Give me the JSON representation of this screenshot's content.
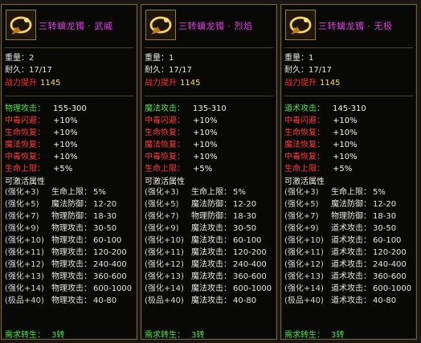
{
  "panels": [
    {
      "title": "三转螭龙镯 · 武威",
      "weight_label": "重量：",
      "weight": "2",
      "durability_label": "耐久：",
      "durability": "17/17",
      "power_label": "战力提升",
      "power_value": "1145",
      "attributes": [
        {
          "label": "物理攻击：",
          "value": "155-300",
          "color": "green"
        },
        {
          "label": "中毒闪避：",
          "value": "+10%",
          "color": "red"
        },
        {
          "label": "生命恢复：",
          "value": "+10%",
          "color": "red"
        },
        {
          "label": "魔法恢复：",
          "value": "+10%",
          "color": "red"
        },
        {
          "label": "中毒恢复：",
          "value": "+10%",
          "color": "red"
        },
        {
          "label": "生命上限：",
          "value": "+5%",
          "color": "red"
        }
      ],
      "activate_title": "可激活属性",
      "enhancements": [
        {
          "level": "强化+3)",
          "attr": "生命上限：",
          "value": "5%"
        },
        {
          "level": "强化+5)",
          "attr": "魔法防御：",
          "value": "12-20"
        },
        {
          "level": "强化+7)",
          "attr": "物理防御：",
          "value": "18-30"
        },
        {
          "level": "强化+9)",
          "attr": "物理攻击：",
          "value": "30-50"
        },
        {
          "level": "强化+10)",
          "attr": "物理攻击：",
          "value": "60-100"
        },
        {
          "level": "强化+11)",
          "attr": "物理攻击：",
          "value": "120-200"
        },
        {
          "level": "强化+12)",
          "attr": "物理攻击：",
          "value": "240-400"
        },
        {
          "level": "强化+13)",
          "attr": "物理攻击：",
          "value": "360-600"
        },
        {
          "level": "强化+14)",
          "attr": "物理攻击：",
          "value": "600-1000"
        },
        {
          "level": "(极品+40)",
          "attr": "物理攻击：",
          "value": "40-80"
        }
      ],
      "require_label": "需求转生：",
      "require_value": "3转"
    },
    {
      "title": "三转螭龙镯 · 烈焰",
      "weight_label": "重量：",
      "weight": "1",
      "durability_label": "耐久：",
      "durability": "17/17",
      "power_label": "战力提升",
      "power_value": "1145",
      "attributes": [
        {
          "label": "魔法攻击：",
          "value": "135-310",
          "color": "green"
        },
        {
          "label": "中毒闪避：",
          "value": "+10%",
          "color": "red"
        },
        {
          "label": "生命恢复：",
          "value": "+10%",
          "color": "red"
        },
        {
          "label": "魔法恢复：",
          "value": "+10%",
          "color": "red"
        },
        {
          "label": "中毒恢复：",
          "value": "+10%",
          "color": "red"
        },
        {
          "label": "生命上限：",
          "value": "+5%",
          "color": "red"
        }
      ],
      "activate_title": "可激活属性",
      "enhancements": [
        {
          "level": "强化+3)",
          "attr": "生命上限：",
          "value": "5%"
        },
        {
          "level": "强化+5)",
          "attr": "魔法防御：",
          "value": "12-20"
        },
        {
          "level": "强化+7)",
          "attr": "物理防御：",
          "value": "18-30"
        },
        {
          "level": "强化+9)",
          "attr": "魔法攻击：",
          "value": "30-50"
        },
        {
          "level": "强化+10)",
          "attr": "魔法攻击：",
          "value": "60-100"
        },
        {
          "level": "强化+11)",
          "attr": "魔法攻击：",
          "value": "120-200"
        },
        {
          "level": "强化+12)",
          "attr": "魔法攻击：",
          "value": "240-400"
        },
        {
          "level": "强化+13)",
          "attr": "魔法攻击：",
          "value": "360-600"
        },
        {
          "level": "强化+14)",
          "attr": "魔法攻击：",
          "value": "600-1000"
        },
        {
          "level": "(极品+40)",
          "attr": "魔法攻击：",
          "value": "40-80"
        }
      ],
      "require_label": "需求转生：",
      "require_value": "3转"
    },
    {
      "title": "三转螭龙镯 · 无极",
      "weight_label": "重量：",
      "weight": "1",
      "durability_label": "耐久：",
      "durability": "17/17",
      "power_label": "战力提升",
      "power_value": "1145",
      "attributes": [
        {
          "label": "道术攻击：",
          "value": "145-310",
          "color": "green"
        },
        {
          "label": "中毒闪避：",
          "value": "+10%",
          "color": "red"
        },
        {
          "label": "生命恢复：",
          "value": "+10%",
          "color": "red"
        },
        {
          "label": "魔法恢复：",
          "value": "+10%",
          "color": "red"
        },
        {
          "label": "中毒恢复：",
          "value": "+10%",
          "color": "red"
        },
        {
          "label": "生命上限：",
          "value": "+5%",
          "color": "red"
        }
      ],
      "activate_title": "可激活属性",
      "enhancements": [
        {
          "level": "强化+3)",
          "attr": "生命上限：",
          "value": "5%"
        },
        {
          "level": "强化+5)",
          "attr": "魔法防御：",
          "value": "12-20"
        },
        {
          "level": "强化+7)",
          "attr": "物理防御：",
          "value": "18-30"
        },
        {
          "level": "强化+9)",
          "attr": "道术攻击：",
          "value": "30-50"
        },
        {
          "level": "强化+10)",
          "attr": "道术攻击：",
          "value": "60-100"
        },
        {
          "level": "强化+11)",
          "attr": "道术攻击：",
          "value": "120-200"
        },
        {
          "level": "强化+12)",
          "attr": "道术攻击：",
          "value": "240-400"
        },
        {
          "level": "强化+13)",
          "attr": "道术攻击：",
          "value": "360-600"
        },
        {
          "level": "强化+14)",
          "attr": "道术攻击：",
          "value": "600-1000"
        },
        {
          "level": "(极品+40)",
          "attr": "道术攻击：",
          "value": "40-80"
        }
      ],
      "require_label": "需求转生：",
      "require_value": "3转"
    }
  ],
  "colors": {
    "title": "#e13de0",
    "power_label": "#ff2f2f",
    "power_value": "#ffe13a",
    "green": "#4fe14f",
    "red": "#ff3b3b"
  },
  "item_icon": "bracelet-icon"
}
